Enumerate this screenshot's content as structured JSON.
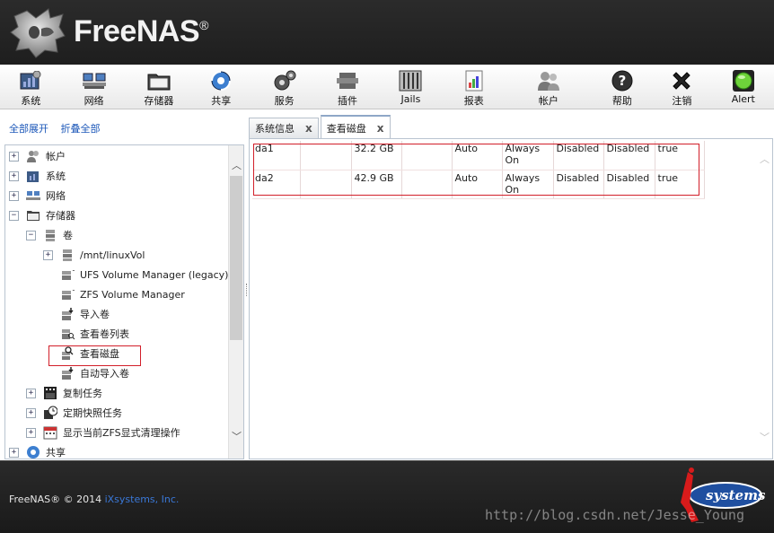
{
  "header": {
    "brand": "FreeNAS",
    "brand_mark": "®"
  },
  "toolbar": {
    "items": [
      {
        "label": "系统",
        "icon": "system-icon"
      },
      {
        "label": "网络",
        "icon": "network-icon"
      },
      {
        "label": "存储器",
        "icon": "storage-icon"
      },
      {
        "label": "共享",
        "icon": "sharing-icon"
      },
      {
        "label": "服务",
        "icon": "services-icon"
      },
      {
        "label": "插件",
        "icon": "plugins-icon"
      },
      {
        "label": "Jails",
        "icon": "jails-icon"
      },
      {
        "label": "报表",
        "icon": "reporting-icon"
      },
      {
        "label": "帐户",
        "icon": "account-icon"
      },
      {
        "label": "帮助",
        "icon": "help-icon"
      },
      {
        "label": "注销",
        "icon": "logout-icon"
      },
      {
        "label": "Alert",
        "icon": "alert-icon"
      }
    ]
  },
  "left": {
    "expand_all": "全部展开",
    "collapse_all": "折叠全部"
  },
  "tree": {
    "items": [
      {
        "label": "帐户",
        "exp": "+"
      },
      {
        "label": "系统",
        "exp": "+"
      },
      {
        "label": "网络",
        "exp": "+"
      },
      {
        "label": "存储器",
        "exp": "−"
      },
      {
        "label": "卷",
        "exp": "−"
      },
      {
        "label": "/mnt/linuxVol",
        "exp": "+"
      },
      {
        "label": "UFS Volume Manager (legacy)",
        "exp": ""
      },
      {
        "label": "ZFS Volume Manager",
        "exp": ""
      },
      {
        "label": "导入卷",
        "exp": ""
      },
      {
        "label": "查看卷列表",
        "exp": ""
      },
      {
        "label": "查看磁盘",
        "exp": ""
      },
      {
        "label": "自动导入卷",
        "exp": ""
      },
      {
        "label": "复制任务",
        "exp": "+"
      },
      {
        "label": "定期快照任务",
        "exp": "+"
      },
      {
        "label": "显示当前ZFS显式清理操作",
        "exp": "+"
      },
      {
        "label": "共享",
        "exp": "+"
      }
    ]
  },
  "tabs": [
    {
      "label": "系统信息",
      "close": "x"
    },
    {
      "label": "查看磁盘",
      "close": "x"
    }
  ],
  "disks": {
    "rows": [
      {
        "name": "da1",
        "c2": "",
        "size": "32.2 GB",
        "c4": "",
        "mode": "Auto",
        "standby": "Always On",
        "c7": "Disabled",
        "c8": "Disabled",
        "c9": "true"
      },
      {
        "name": "da2",
        "c2": "",
        "size": "42.9 GB",
        "c4": "",
        "mode": "Auto",
        "standby": "Always On",
        "c7": "Disabled",
        "c8": "Disabled",
        "c9": "true"
      }
    ]
  },
  "footer": {
    "copyright": "FreeNAS® © 2014 ",
    "company": "iXsystems, Inc.",
    "ix_text": "systems",
    "watermark": "http://blog.csdn.net/Jesse_Young"
  },
  "colors": {
    "highlight": "#d21f2a",
    "link": "#1a56b8",
    "header_bg": "#2b2b2b"
  }
}
